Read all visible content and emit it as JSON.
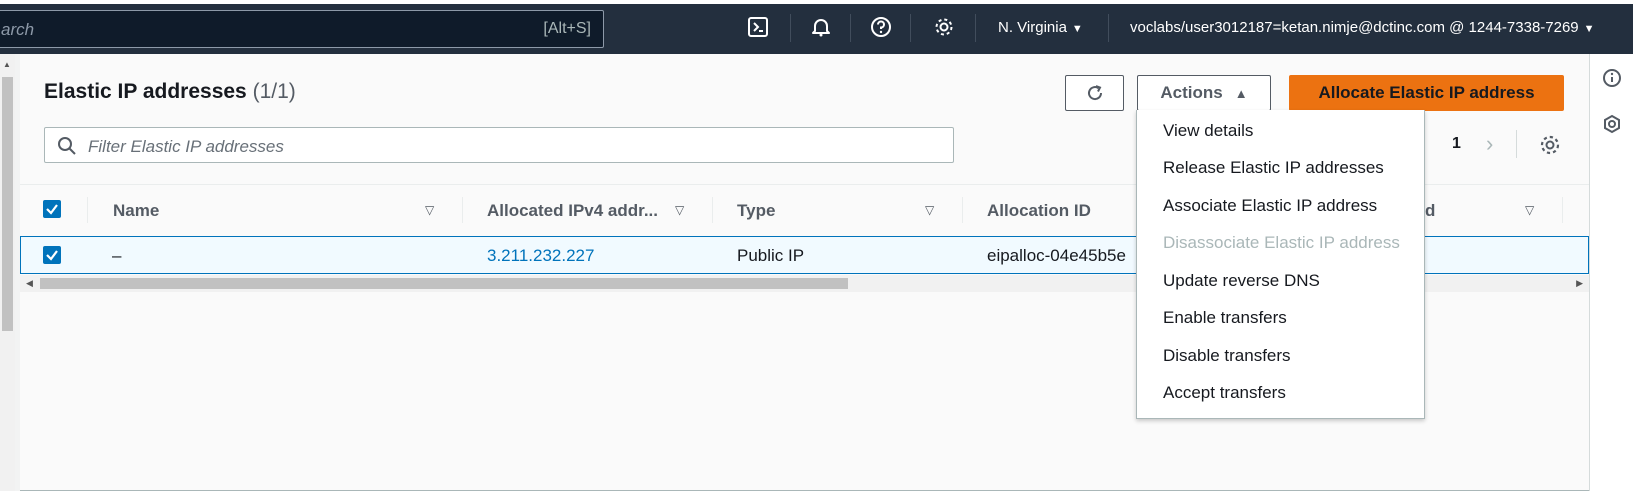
{
  "topbar": {
    "search_text": "arch",
    "search_hint": "[Alt+S]",
    "icons": [
      "cloudshell-icon",
      "bell-icon",
      "help-icon",
      "settings-icon"
    ],
    "region": "N. Virginia",
    "account": "voclabs/user3012187=ketan.nimje@dctinc.com @ 1244-7338-7269"
  },
  "page": {
    "title": "Elastic IP addresses",
    "count": "(1/1)",
    "refresh_icon": "refresh-icon",
    "actions_label": "Actions",
    "allocate_label": "Allocate Elastic IP address",
    "filter_placeholder": "Filter Elastic IP addresses",
    "page_number": "1"
  },
  "table": {
    "columns": [
      "Name",
      "Allocated IPv4 addr...",
      "Type",
      "Allocation ID",
      "ord"
    ],
    "rows": [
      {
        "name": "–",
        "ip": "3.211.232.227",
        "type": "Public IP",
        "allocation_id": "eipalloc-04e45b5e"
      }
    ]
  },
  "actions_menu": {
    "items": [
      {
        "label": "View details",
        "disabled": false
      },
      {
        "label": "Release Elastic IP addresses",
        "disabled": false
      },
      {
        "label": "Associate Elastic IP address",
        "disabled": false
      },
      {
        "label": "Disassociate Elastic IP address",
        "disabled": true
      },
      {
        "label": "Update reverse DNS",
        "disabled": false
      },
      {
        "label": "Enable transfers",
        "disabled": false
      },
      {
        "label": "Disable transfers",
        "disabled": false
      },
      {
        "label": "Accept transfers",
        "disabled": false
      }
    ]
  },
  "colors": {
    "topbar": "#232f3e",
    "primary": "#ec7211",
    "link": "#0073bb",
    "selected_row": "#f1faff"
  }
}
